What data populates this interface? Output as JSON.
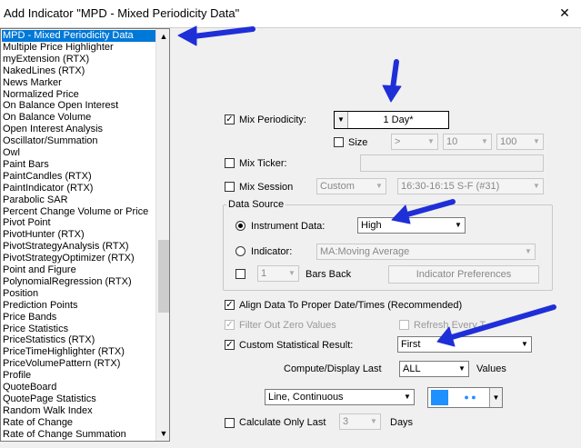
{
  "window": {
    "title": "Add Indicator \"MPD - Mixed Periodicity Data\"",
    "close_glyph": "✕"
  },
  "indicator_list": {
    "selected_index": 0,
    "items": [
      "MPD - Mixed Periodicity Data",
      "Multiple Price Highlighter",
      "myExtension (RTX)",
      "NakedLines (RTX)",
      "News Marker",
      "Normalized Price",
      "On Balance Open Interest",
      "On Balance Volume",
      "Open Interest Analysis",
      "Oscillator/Summation",
      "Owl",
      "Paint Bars",
      "PaintCandles (RTX)",
      "PaintIndicator (RTX)",
      "Parabolic SAR",
      "Percent Change Volume or Price",
      "Pivot Point",
      "PivotHunter (RTX)",
      "PivotStrategyAnalysis (RTX)",
      "PivotStrategyOptimizer (RTX)",
      "Point and Figure",
      "PolynomialRegression (RTX)",
      "Position",
      "Prediction Points",
      "Price Bands",
      "Price Statistics",
      "PriceStatistics (RTX)",
      "PriceTimeHighlighter (RTX)",
      "PriceVolumePattern (RTX)",
      "Profile",
      "QuoteBoard",
      "QuotePage Statistics",
      "Random Walk Index",
      "Rate of Change",
      "Rate of Change Summation"
    ]
  },
  "mix_periodicity": {
    "label": "Mix Periodicity:",
    "checked": true,
    "value": "1 Day*"
  },
  "size": {
    "label": "Size",
    "checked": false,
    "operator": ">",
    "value1": "10",
    "value2": "100"
  },
  "mix_ticker": {
    "label": "Mix Ticker:",
    "checked": false,
    "value": ""
  },
  "mix_session": {
    "label": "Mix Session",
    "checked": false,
    "type": "Custom",
    "session": "16:30-16:15 S-F (#31)"
  },
  "data_source": {
    "title": "Data Source",
    "instrument_data": {
      "label": "Instrument Data:",
      "selected": true,
      "value": "High"
    },
    "indicator": {
      "label": "Indicator:",
      "selected": false,
      "value": "MA:Moving Average"
    },
    "bars_back": {
      "label": "Bars Back",
      "checked": false,
      "value": "1"
    },
    "preferences_button": "Indicator Preferences"
  },
  "align_data": {
    "label": "Align Data To Proper Date/Times (Recommended)",
    "checked": true
  },
  "filter_zero": {
    "label": "Filter Out Zero Values",
    "checked": true,
    "disabled": true
  },
  "refresh_every": {
    "label": "Refresh Every T",
    "checked": false,
    "disabled": true
  },
  "custom_stat": {
    "label": "Custom Statistical Result:",
    "checked": true,
    "value": "First"
  },
  "compute_display": {
    "label": "Compute/Display Last",
    "value": "ALL",
    "suffix": "Values"
  },
  "plot_style": {
    "value": "Line, Continuous",
    "color": "#1e90ff",
    "marker_glyph": "● ●"
  },
  "calc_only_last": {
    "label": "Calculate Only Last",
    "checked": false,
    "value": "3",
    "suffix": "Days"
  },
  "colors": {
    "selection": "#0078d7",
    "annotation_arrow": "#1f2fd8"
  },
  "check_glyph": "✓",
  "dropdown_glyph": "▼",
  "scroll_up_glyph": "▲",
  "scroll_down_glyph": "▼"
}
